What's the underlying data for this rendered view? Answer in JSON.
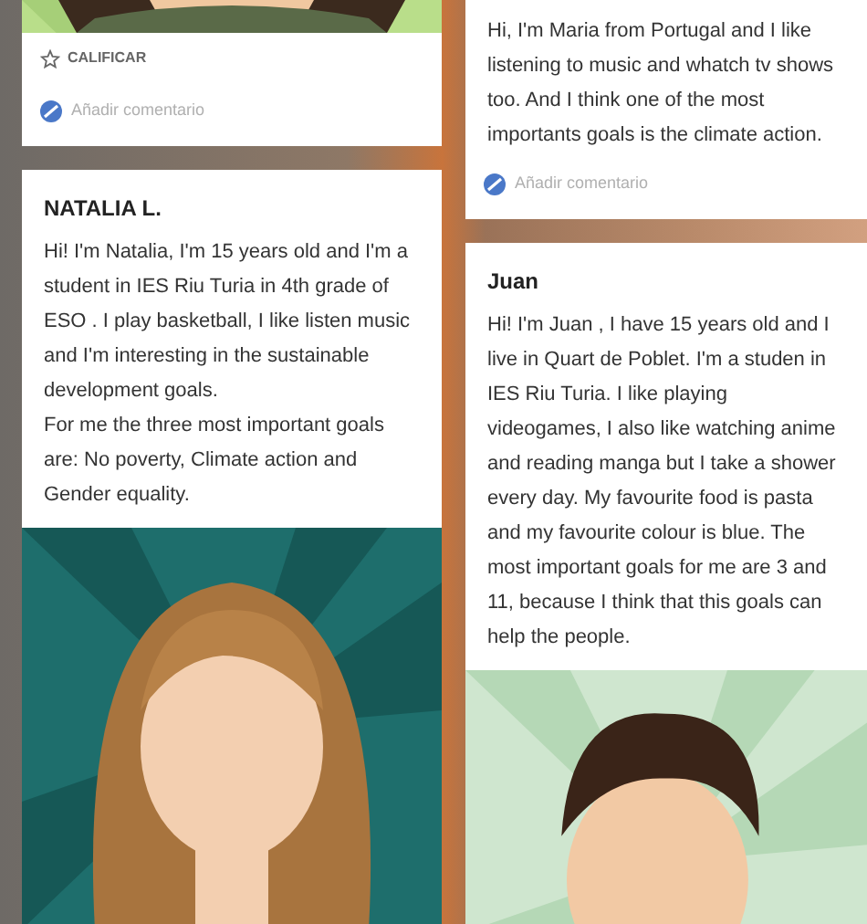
{
  "columns": [
    {
      "posts": [
        {
          "parts": [
            {
              "kind": "picture"
            },
            {
              "kind": "rating",
              "label": "CALIFICAR"
            },
            {
              "kind": "comment",
              "placeholder": "Añadir comentario"
            }
          ]
        },
        {
          "parts": [
            {
              "kind": "title",
              "text": "NATALIA L."
            },
            {
              "kind": "body",
              "text": "Hi! I'm Natalia, I'm 15 years old and I'm a student in IES Riu Turia in 4th grade of ESO . I play basketball, I like listen music and I'm interesting in the sustainable development goals.\nFor me the three most important goals are: No poverty, Climate action and Gender equality."
            },
            {
              "kind": "picture"
            }
          ]
        }
      ]
    },
    {
      "posts": [
        {
          "parts": [
            {
              "kind": "body",
              "text": "Hi, I'm Maria from Portugal and I like listening to music and whatch tv shows too. And I think one of the most importants goals is the climate action."
            },
            {
              "kind": "comment",
              "placeholder": "Añadir comentario"
            }
          ]
        },
        {
          "parts": [
            {
              "kind": "title",
              "text": "Juan"
            },
            {
              "kind": "body",
              "text": "Hi! I'm Juan , I have 15 years old and I live in Quart de Poblet. I'm a studen in IES Riu Turia. I like playing videogames, I also like watching anime and reading manga but I take a shower every day. My favourite food is pasta and my favourite colour is blue. The most important goals for me are 3 and 11, because I think that this goals can help the people."
            },
            {
              "kind": "picture"
            }
          ]
        }
      ]
    }
  ]
}
